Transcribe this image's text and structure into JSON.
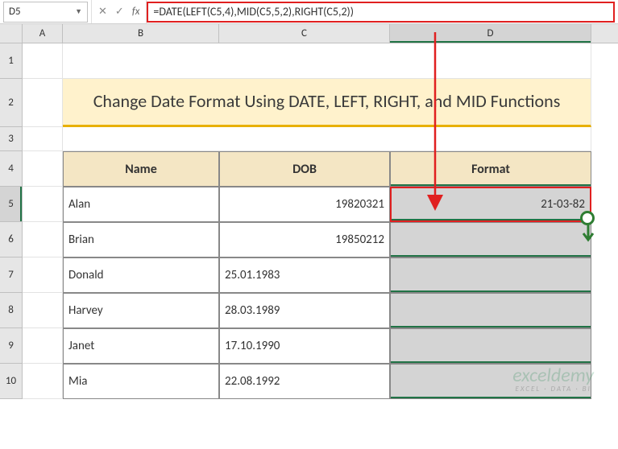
{
  "nameBox": "D5",
  "formula": "=DATE(LEFT(C5,4),MID(C5,5,2),RIGHT(C5,2))",
  "columns": [
    "A",
    "B",
    "C",
    "D"
  ],
  "title": "Change Date Format Using DATE, LEFT, RIGHT, and MID Functions",
  "headers": {
    "name": "Name",
    "dob": "DOB",
    "format": "Format"
  },
  "rows": [
    {
      "name": "Alan",
      "dob": "19820321",
      "format": "21-03-82"
    },
    {
      "name": "Brian",
      "dob": "19850212",
      "format": ""
    },
    {
      "name": "Donald",
      "dob": "25.01.1983",
      "format": ""
    },
    {
      "name": "Harvey",
      "dob": "28.03.1989",
      "format": ""
    },
    {
      "name": "Janet",
      "dob": "17.10.1990",
      "format": ""
    },
    {
      "name": "Mia",
      "dob": "22.08.1992",
      "format": ""
    }
  ],
  "rowNumbers": [
    "1",
    "2",
    "3",
    "4",
    "5",
    "6",
    "7",
    "8",
    "9",
    "10"
  ],
  "watermark": {
    "brand": "exceldemy",
    "tagline": "EXCEL · DATA · BI"
  },
  "fx": "fx"
}
